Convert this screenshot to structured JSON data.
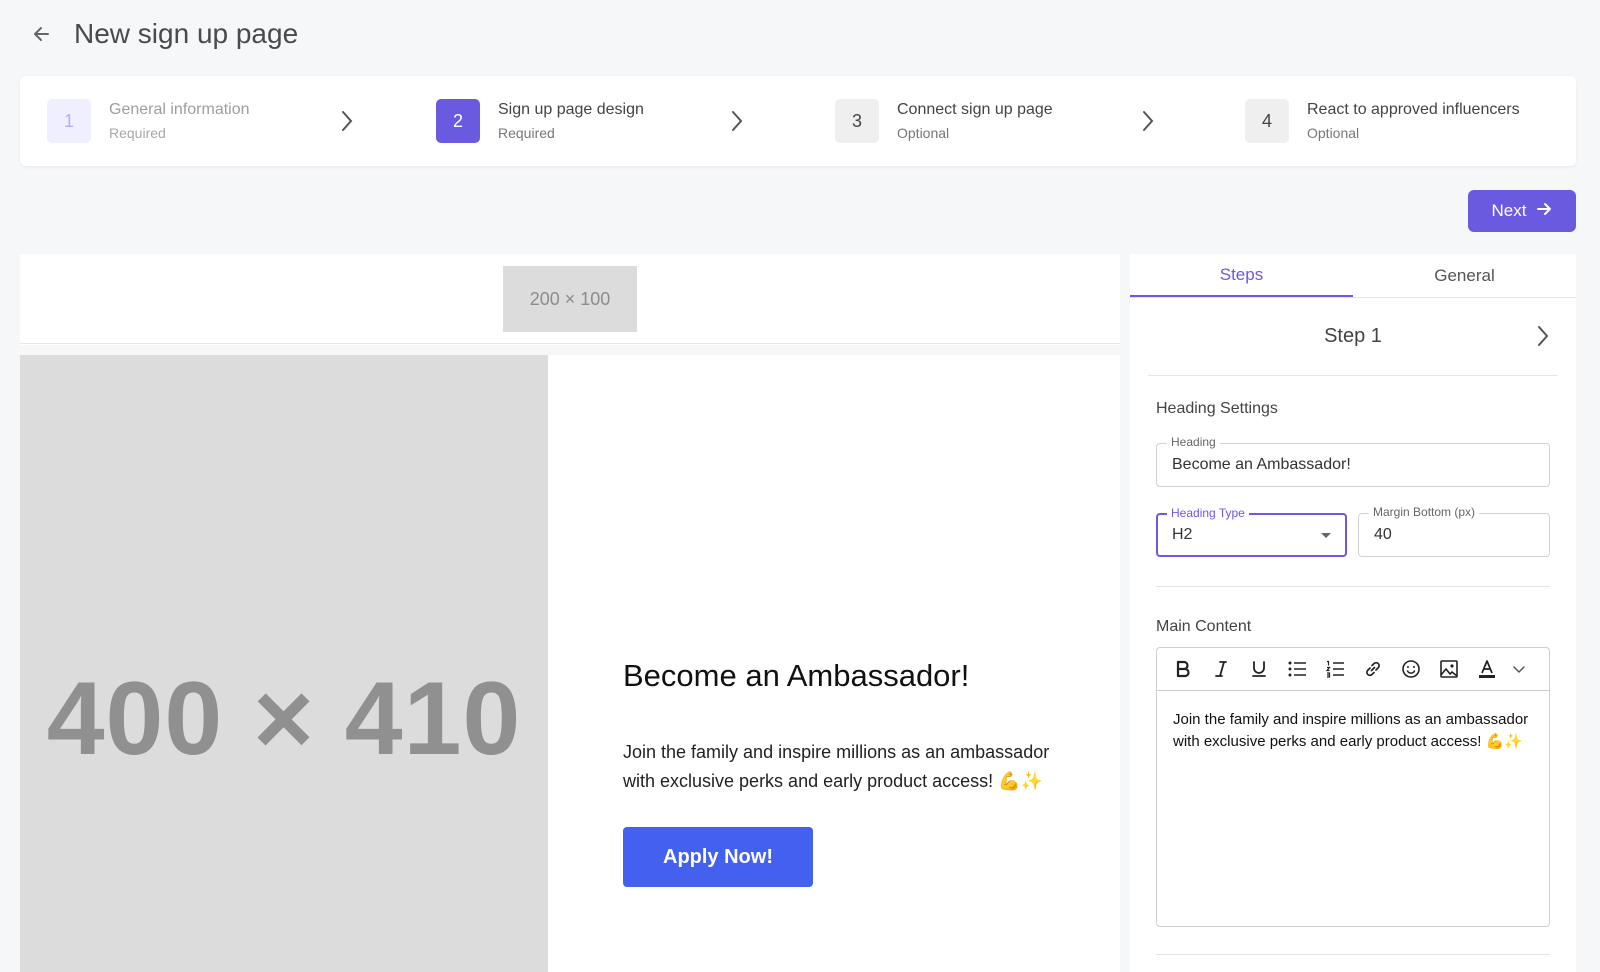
{
  "header": {
    "title": "New sign up page"
  },
  "stepper": [
    {
      "num": "1",
      "title": "General information",
      "sub": "Required"
    },
    {
      "num": "2",
      "title": "Sign up page design",
      "sub": "Required"
    },
    {
      "num": "3",
      "title": "Connect sign up page",
      "sub": "Optional"
    },
    {
      "num": "4",
      "title": "React to approved influencers",
      "sub": "Optional"
    }
  ],
  "actions": {
    "next_label": "Next"
  },
  "preview": {
    "logo_placeholder": "200 × 100",
    "image_placeholder": "400 × 410",
    "heading": "Become an Ambassador!",
    "body": "Join the family and inspire millions as an ambassador with exclusive perks and early product access! 💪✨",
    "cta": "Apply Now!"
  },
  "panel": {
    "tabs": [
      "Steps",
      "General"
    ],
    "active_tab": "Steps",
    "step_title": "Step 1",
    "heading_settings": {
      "section": "Heading Settings",
      "heading_label": "Heading",
      "heading_value": "Become an Ambassador!",
      "type_label": "Heading Type",
      "type_value": "H2",
      "margin_label": "Margin Bottom (px)",
      "margin_value": "40"
    },
    "main_content": {
      "section": "Main Content",
      "text": "Join the family and inspire millions as an ambassador with exclusive perks and early product access! 💪✨"
    }
  },
  "colors": {
    "accent": "#6a5ae0",
    "cta": "#4361ee",
    "placeholder": "#dcdcdc"
  }
}
